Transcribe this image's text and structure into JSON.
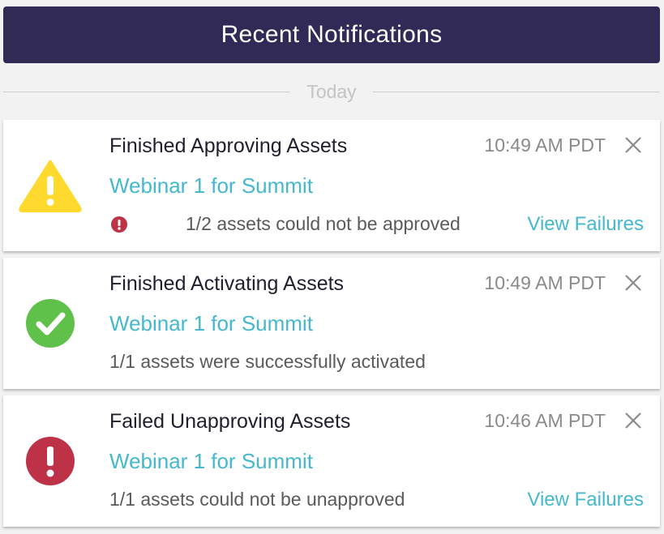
{
  "header": {
    "title": "Recent Notifications"
  },
  "divider": {
    "label": "Today"
  },
  "notifications": [
    {
      "title": "Finished Approving Assets",
      "time": "10:49 AM PDT",
      "link": "Webinar 1 for Summit",
      "status": "1/2 assets could not be approved",
      "action": "View Failures",
      "icon": "warning-icon",
      "icon_color": "#ffd92e"
    },
    {
      "title": "Finished Activating Assets",
      "time": "10:49 AM PDT",
      "link": "Webinar 1 for Summit",
      "status": "1/1 assets were successfully activated",
      "action": "",
      "icon": "check-circle-icon",
      "icon_color": "#5fc04a"
    },
    {
      "title": "Failed Unapproving Assets",
      "time": "10:46 AM PDT",
      "link": "Webinar 1 for Summit",
      "status": "1/1 assets could not be unapproved",
      "action": "View Failures",
      "icon": "error-circle-icon",
      "icon_color": "#be3247"
    }
  ],
  "colors": {
    "header_bg": "#322a56",
    "link": "#45b8cd",
    "error_dot": "#be3247"
  }
}
